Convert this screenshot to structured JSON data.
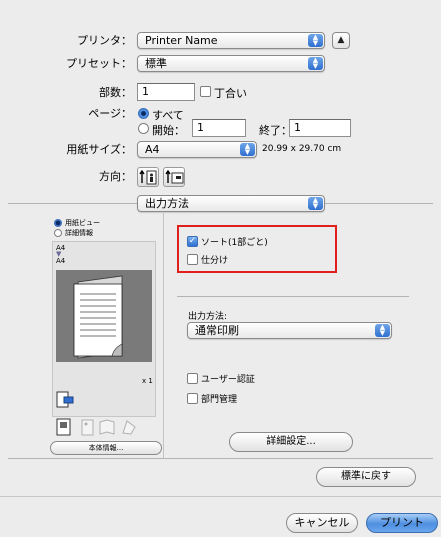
{
  "printer": {
    "label": "プリンタ：",
    "value": "Printer Name"
  },
  "preset": {
    "label": "プリセット：",
    "value": "標準"
  },
  "copies": {
    "label": "部数：",
    "value": "1",
    "collate_label": "丁合い"
  },
  "pages": {
    "label": "ページ：",
    "all_label": "すべて",
    "from_label": "開始：",
    "from_value": "1",
    "to_label": "終了：",
    "to_value": "1"
  },
  "paper_size": {
    "label": "用紙サイズ：",
    "value": "A4",
    "dimensions": "20.99 x 29.70 cm"
  },
  "orientation": {
    "label": "方向："
  },
  "pane": {
    "value": "出力方法"
  },
  "preview": {
    "radio_paper": "用紙ビュー",
    "radio_detail": "詳細情報",
    "size_top": "A4",
    "size_bottom": "A4",
    "copies": "x 1",
    "info_button": "本体情報..."
  },
  "options": {
    "sort": "ソート(1部ごと)",
    "offset": "仕分け",
    "output_method_label": "出力方法:",
    "output_method_value": "通常印刷",
    "user_auth": "ユーザー認証",
    "dept_mgmt": "部門管理",
    "detail_button": "詳細設定...",
    "default_button": "標準に戻す"
  },
  "footer": {
    "cancel": "キャンセル",
    "print": "プリント"
  },
  "colors": {
    "highlight_box": "#e0201c",
    "accent": "#2f6fd0"
  }
}
